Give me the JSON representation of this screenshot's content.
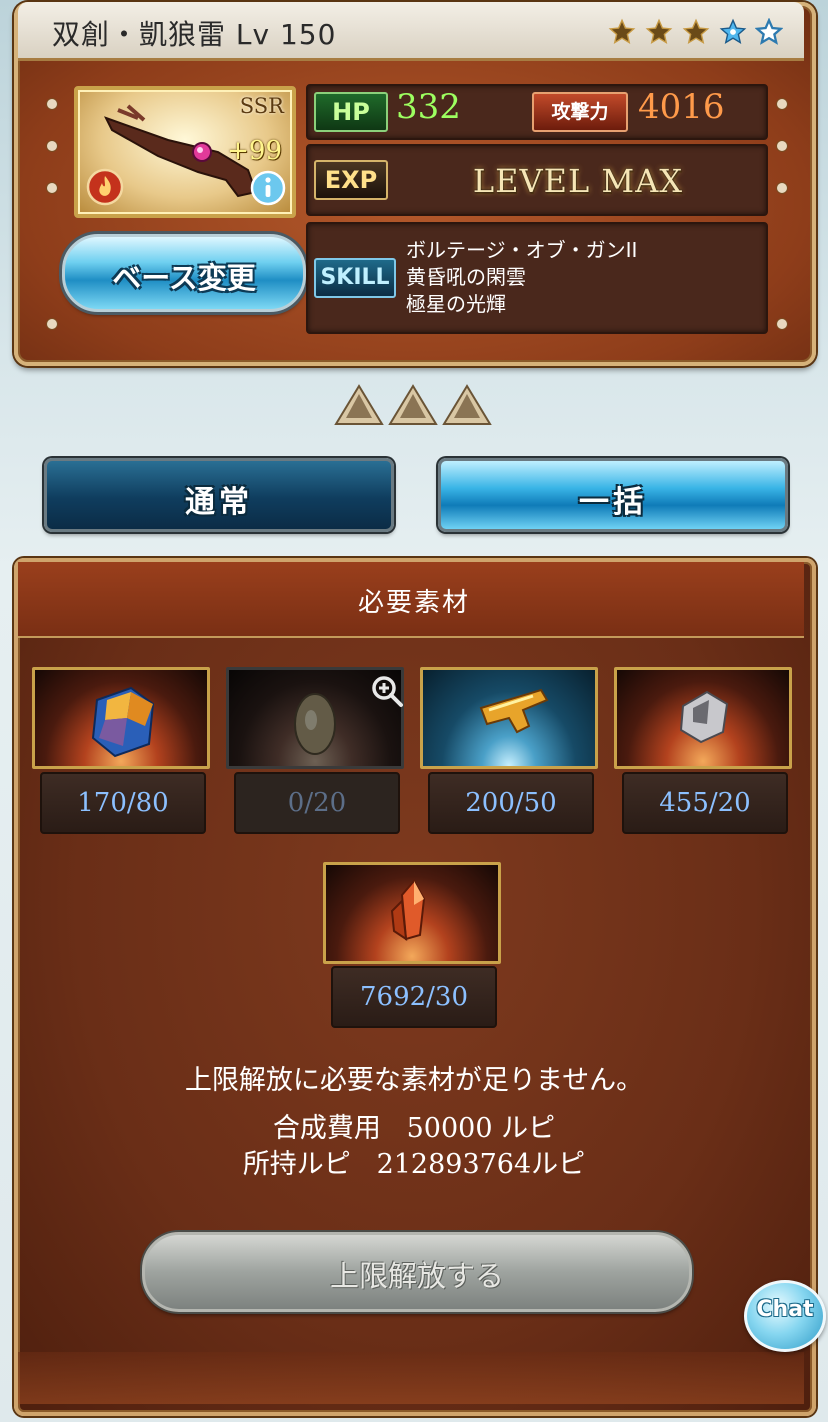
{
  "weapon": {
    "name": "双創・凱狼雷 Lv 150",
    "rarity": "SSR",
    "plus": "+99",
    "element_icon": "fire-element-icon",
    "stars": [
      "gold",
      "gold",
      "gold",
      "blue",
      "blue-outline"
    ]
  },
  "stats": {
    "hp_label": "HP",
    "hp_value": "332",
    "atk_label": "攻撃力",
    "atk_value": "4016",
    "exp_label": "EXP",
    "level_status": "LEVEL MAX"
  },
  "skills": {
    "label": "SKILL",
    "items": [
      "ボルテージ・オブ・ガンII",
      "黄昏吼の閑雲",
      "極星の光輝"
    ]
  },
  "buttons": {
    "base_change": "ベース変更",
    "tab_normal": "通常",
    "tab_bulk": "一括",
    "limit_break": "上限解放する",
    "chat": "Chat"
  },
  "materials": {
    "title": "必要素材",
    "items": [
      {
        "count": "170/80",
        "icon": "blue-crystal-chunk-icon"
      },
      {
        "count": "0/20",
        "icon": "golden-seed-icon"
      },
      {
        "count": "200/50",
        "icon": "golden-gun-icon"
      },
      {
        "count": "455/20",
        "icon": "silver-ore-icon"
      },
      {
        "count": "7692/30",
        "icon": "red-crystal-icon"
      }
    ]
  },
  "messages": {
    "insufficient": "上限解放に必要な素材が足りません。",
    "cost_label": "合成費用",
    "cost_value": "50000 ルピ",
    "owned_label": "所持ルピ",
    "owned_value": "212893764ルピ"
  },
  "colors": {
    "panel_brown": "#8e3d1a",
    "hp_green": "#9dff60",
    "atk_orange": "#ff9a4a",
    "count_blue": "#8cc0ff",
    "button_blue": "#39b4e6"
  }
}
